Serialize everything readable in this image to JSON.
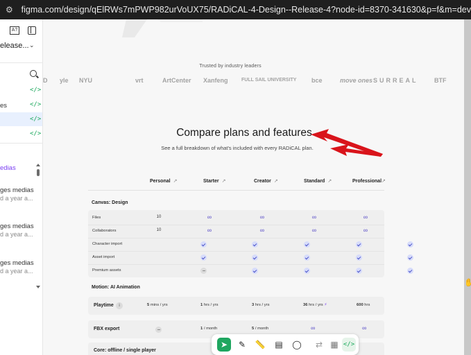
{
  "browser": {
    "url": "figma.com/design/qElRWs7mPWP982urVoUX75/RADiCAL-4-Design--Release-4?node-id=8370-341630&p=f&m=dev"
  },
  "left_panel": {
    "project_title": "elease...",
    "layers": [
      {
        "label": "",
        "code": "</>"
      },
      {
        "label": "es",
        "code": "</>"
      },
      {
        "label": "",
        "code": "</>"
      },
      {
        "label": "",
        "code": "</>"
      }
    ],
    "section_label": "edias",
    "items": [
      {
        "title": "ges medias",
        "meta": "d a year a..."
      },
      {
        "title": "ges medias",
        "meta": "d a year a..."
      },
      {
        "title": "ges medias",
        "meta": "d a year a..."
      }
    ]
  },
  "page": {
    "trusted_label": "Trusted by industry leaders",
    "logos": [
      "D",
      "yle",
      "NYU",
      "vrt",
      "ArtCenter",
      "Xanfeng",
      "FULL SAIL UNIVERSITY",
      "bce",
      "move ones",
      "SURREAL",
      "BTF"
    ],
    "title": "Compare plans and features",
    "subtitle": "See a full breakdown of what's included with every RADiCAL plan.",
    "plans": [
      "Personal",
      "Starter",
      "Creator",
      "Standard",
      "Professional"
    ],
    "plan_link_arrow": "↗",
    "sections": {
      "canvas_design": "Canvas: Design",
      "motion": "Motion: AI Animation",
      "core": "Core: offline / single player"
    },
    "rows": {
      "files": {
        "label": "Files",
        "values": [
          "10",
          "∞",
          "∞",
          "∞",
          "∞"
        ]
      },
      "collaborators": {
        "label": "Collaborators",
        "values": [
          "10",
          "∞",
          "∞",
          "∞",
          "∞"
        ]
      },
      "character_import": {
        "label": "Character import"
      },
      "asset_import": {
        "label": "Asset import"
      },
      "premium_assets": {
        "label": "Premium assets"
      }
    },
    "playtime": {
      "label": "Playtime",
      "info": "i",
      "values": [
        {
          "num": "5",
          "unit": "mins / yrs"
        },
        {
          "num": "1",
          "unit": "hrs / yrs"
        },
        {
          "num": "3",
          "unit": "hrs / yrs"
        },
        {
          "num": "36",
          "unit": "hrs / yrs"
        },
        {
          "num": "600",
          "unit": "hrs"
        }
      ]
    },
    "fbx": {
      "label": "FBX export",
      "values": [
        "1",
        "/ month",
        "5",
        "/ month",
        "∞",
        "∞"
      ]
    }
  },
  "toolbar": {
    "tools": [
      "move-tool",
      "pen-tool",
      "ruler-tool",
      "annotate-tool",
      "comment-tool",
      "compare-tool",
      "ready-tool",
      "dev-mode"
    ],
    "dev_label": "</>"
  },
  "colors": {
    "accent_green": "#1fa660",
    "check_bg": "#d7dcfa",
    "infinity": "#5b4fc8",
    "arrow_red": "#d9141b"
  }
}
